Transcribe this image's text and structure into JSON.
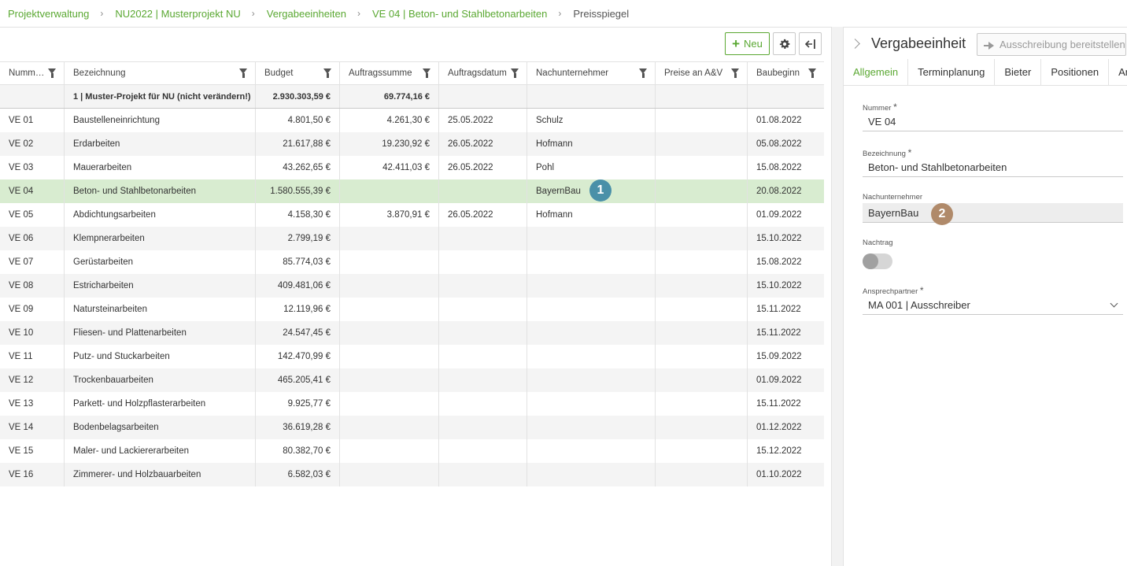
{
  "breadcrumb": [
    {
      "label": "Projektverwaltung"
    },
    {
      "label": "NU2022 | Musterprojekt NU"
    },
    {
      "label": "Vergabeeinheiten"
    },
    {
      "label": "VE 04 | Beton- und Stahlbetonarbeiten"
    },
    {
      "label": "Preisspiegel"
    }
  ],
  "toolbar": {
    "new_label": "Neu",
    "settings_icon": "gear-icon",
    "collapse_icon": "collapse-right-icon"
  },
  "table": {
    "columns": [
      "Numm…",
      "Bezeichnung",
      "Budget",
      "Auftragssumme",
      "Auftragsdatum",
      "Nachunternehmer",
      "Preise an A&V",
      "Baubeginn"
    ],
    "summary": {
      "label": "1 | Muster-Projekt für NU (nicht verändern!)",
      "budget": "2.930.303,59 €",
      "auftragssumme": "69.774,16 €"
    },
    "rows": [
      [
        "VE 01",
        "Baustelleneinrichtung",
        "4.801,50 €",
        "4.261,30 €",
        "25.05.2022",
        "Schulz",
        "",
        "01.08.2022"
      ],
      [
        "VE 02",
        "Erdarbeiten",
        "21.617,88 €",
        "19.230,92 €",
        "26.05.2022",
        "Hofmann",
        "",
        "05.08.2022"
      ],
      [
        "VE 03",
        "Mauerarbeiten",
        "43.262,65 €",
        "42.411,03 €",
        "26.05.2022",
        "Pohl",
        "",
        "15.08.2022"
      ],
      [
        "VE 04",
        "Beton- und Stahlbetonarbeiten",
        "1.580.555,39 €",
        "",
        "",
        "BayernBau",
        "",
        "20.08.2022"
      ],
      [
        "VE 05",
        "Abdichtungsarbeiten",
        "4.158,30 €",
        "3.870,91 €",
        "26.05.2022",
        "Hofmann",
        "",
        "01.09.2022"
      ],
      [
        "VE 06",
        "Klempnerarbeiten",
        "2.799,19 €",
        "",
        "",
        "",
        "",
        "15.10.2022"
      ],
      [
        "VE 07",
        "Gerüstarbeiten",
        "85.774,03 €",
        "",
        "",
        "",
        "",
        "15.08.2022"
      ],
      [
        "VE 08",
        "Estricharbeiten",
        "409.481,06 €",
        "",
        "",
        "",
        "",
        "15.10.2022"
      ],
      [
        "VE 09",
        "Natursteinarbeiten",
        "12.119,96 €",
        "",
        "",
        "",
        "",
        "15.11.2022"
      ],
      [
        "VE 10",
        "Fliesen- und Plattenarbeiten",
        "24.547,45 €",
        "",
        "",
        "",
        "",
        "15.11.2022"
      ],
      [
        "VE 11",
        "Putz- und Stuckarbeiten",
        "142.470,99 €",
        "",
        "",
        "",
        "",
        "15.09.2022"
      ],
      [
        "VE 12",
        "Trockenbauarbeiten",
        "465.205,41 €",
        "",
        "",
        "",
        "",
        "01.09.2022"
      ],
      [
        "VE 13",
        "Parkett- und Holzpflasterarbeiten",
        "9.925,77 €",
        "",
        "",
        "",
        "",
        "15.11.2022"
      ],
      [
        "VE 14",
        "Bodenbelagsarbeiten",
        "36.619,28 €",
        "",
        "",
        "",
        "",
        "01.12.2022"
      ],
      [
        "VE 15",
        "Maler- und Lackiererarbeiten",
        "80.382,70 €",
        "",
        "",
        "",
        "",
        "15.12.2022"
      ],
      [
        "VE 16",
        "Zimmerer- und Holzbauarbeiten",
        "6.582,03 €",
        "",
        "",
        "",
        "",
        "01.10.2022"
      ]
    ],
    "selected_row": "VE 04"
  },
  "badges": {
    "one": "1",
    "two": "2"
  },
  "detail": {
    "title": "Vergabeeinheit",
    "share_label": "Ausschreibung bereitstellen",
    "tabs": [
      "Allgemein",
      "Terminplanung",
      "Bieter",
      "Positionen",
      "Anh"
    ],
    "fields": {
      "nummer_label": "Nummer",
      "nummer_value": "VE 04",
      "bezeichnung_label": "Bezeichnung",
      "bezeichnung_value": "Beton- und Stahlbetonarbeiten",
      "nu_label": "Nachunternehmer",
      "nu_value": "BayernBau",
      "nachtrag_label": "Nachtrag",
      "ansprech_label": "Ansprechpartner",
      "ansprech_value": "MA 001 | Ausschreiber"
    },
    "required_mark": "*"
  },
  "colors": {
    "accent": "#5aa832",
    "selected_row": "#d8ecd0",
    "badge1": "#4a90a8",
    "badge2": "#b08a6a"
  }
}
